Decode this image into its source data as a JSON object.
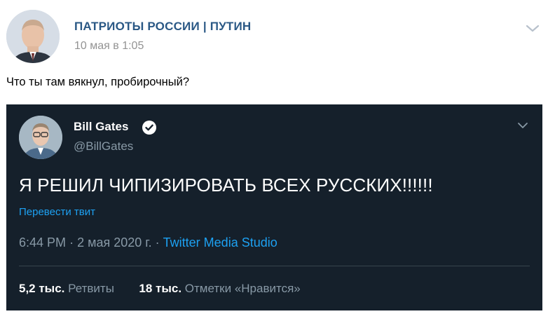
{
  "post": {
    "group_name": "ПАТРИОТЫ РОССИИ | ПУТИН",
    "date": "10 мая в 1:05",
    "text": "Что ты там вякнул, пробирочный?",
    "menu_icon": "chevron-down-icon"
  },
  "tweet": {
    "author_name": "Bill Gates",
    "handle": "@BillGates",
    "verified_icon": "verified-badge-icon",
    "text": "Я РЕШИЛ ЧИПИЗИРОВАТЬ ВСЕХ РУССКИХ!!!!!!",
    "translate_label": "Перевести твит",
    "time": "6:44 PM",
    "date": "2 мая 2020 г.",
    "separator": "·",
    "source": "Twitter Media Studio",
    "retweets_count": "5,2 тыс.",
    "retweets_label": "Ретвиты",
    "likes_count": "18 тыс.",
    "likes_label": "Отметки «Нравится»"
  },
  "colors": {
    "vk_link": "#2a5885",
    "tweet_bg": "#15202b",
    "twitter_blue": "#1da1f2",
    "twitter_gray": "#8899a6"
  }
}
